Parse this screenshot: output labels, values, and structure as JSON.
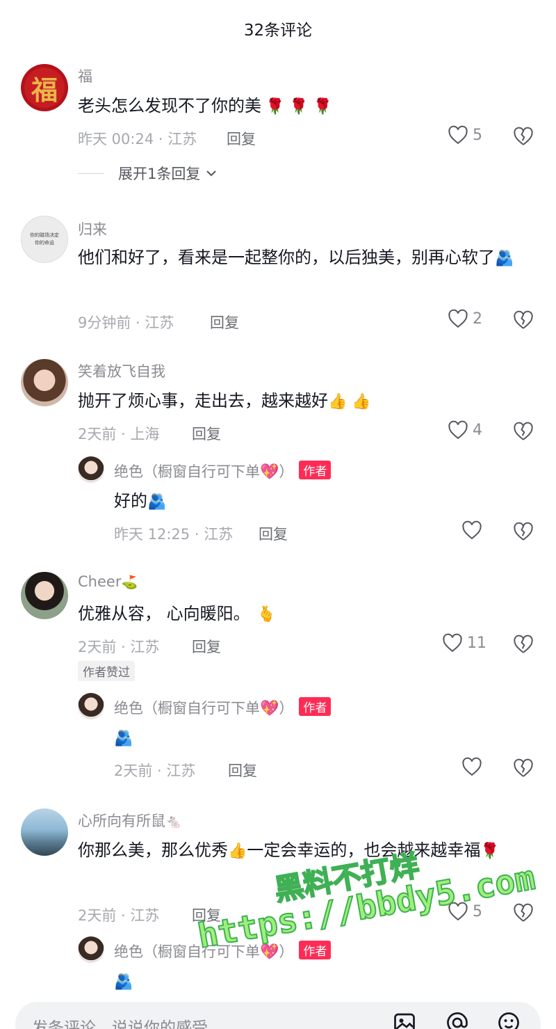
{
  "header": {
    "title": "32条评论"
  },
  "comments": [
    {
      "user": "福",
      "avatar_text": "福",
      "text": "老头怎么发现不了你的美",
      "text_emoji": "🌹 🌹 🌹",
      "meta": "昨天 00:24 · 江苏",
      "reply": "回复",
      "likes": "5",
      "expand": "展开1条回复"
    },
    {
      "user": "归来",
      "avatar_text": "你的磁场决定你的命运",
      "text": "他们和好了，看来是一起整你的，以后独美，别再心软了",
      "text_emoji": "🫂",
      "meta": "9分钟前 · 江苏",
      "reply": "回复",
      "likes": "2"
    },
    {
      "user": "笑着放飞自我",
      "text": "抛开了烦心事，走出去，越来越好",
      "text_emoji": "👍 👍",
      "meta": "2天前 · 上海",
      "reply": "回复",
      "likes": "4",
      "sub": {
        "user": "绝色（橱窗自行可下单",
        "user_emoji": "💖",
        "user_close": "）",
        "tag": "作者",
        "text": "好的",
        "text_emoji": "🫂",
        "meta": "昨天 12:25 · 江苏",
        "reply": "回复"
      }
    },
    {
      "user": "Cheer",
      "user_emoji": "⛳",
      "text": "优雅从容， 心向暖阳。",
      "text_emoji": "🫰",
      "meta": "2天前 · 江苏",
      "reply": "回复",
      "likes": "11",
      "liked_tag": "作者赞过",
      "sub": {
        "user": "绝色（橱窗自行可下单",
        "user_emoji": "💖",
        "user_close": "）",
        "tag": "作者",
        "text": "",
        "text_emoji": "🫂",
        "meta": "2天前 · 江苏",
        "reply": "回复"
      }
    },
    {
      "user": "心所向有所鼠",
      "user_emoji": "🐁",
      "text": "你那么美，那么优秀",
      "text_emoji": "👍",
      "text2": "一定会幸运的，也会越来越幸福",
      "text2_emoji": "🌹",
      "meta": "2天前 · 江苏",
      "reply": "回复",
      "likes": "5",
      "sub": {
        "user": "绝色（橱窗自行可下单",
        "user_emoji": "💖",
        "user_close": "）",
        "tag": "作者",
        "text_emoji": "🫂"
      }
    }
  ],
  "input": {
    "placeholder": "发条评论，说说你的感受",
    "icons": [
      "image-icon",
      "at-icon",
      "emoji-icon"
    ]
  },
  "watermark": {
    "line1": "黑料不打烊",
    "line2": "https://bbdy5.com"
  },
  "colors": {
    "author_tag": "#fe2c55",
    "watermark_fill": "#9ef07a",
    "watermark_stroke": "#3fb054"
  }
}
